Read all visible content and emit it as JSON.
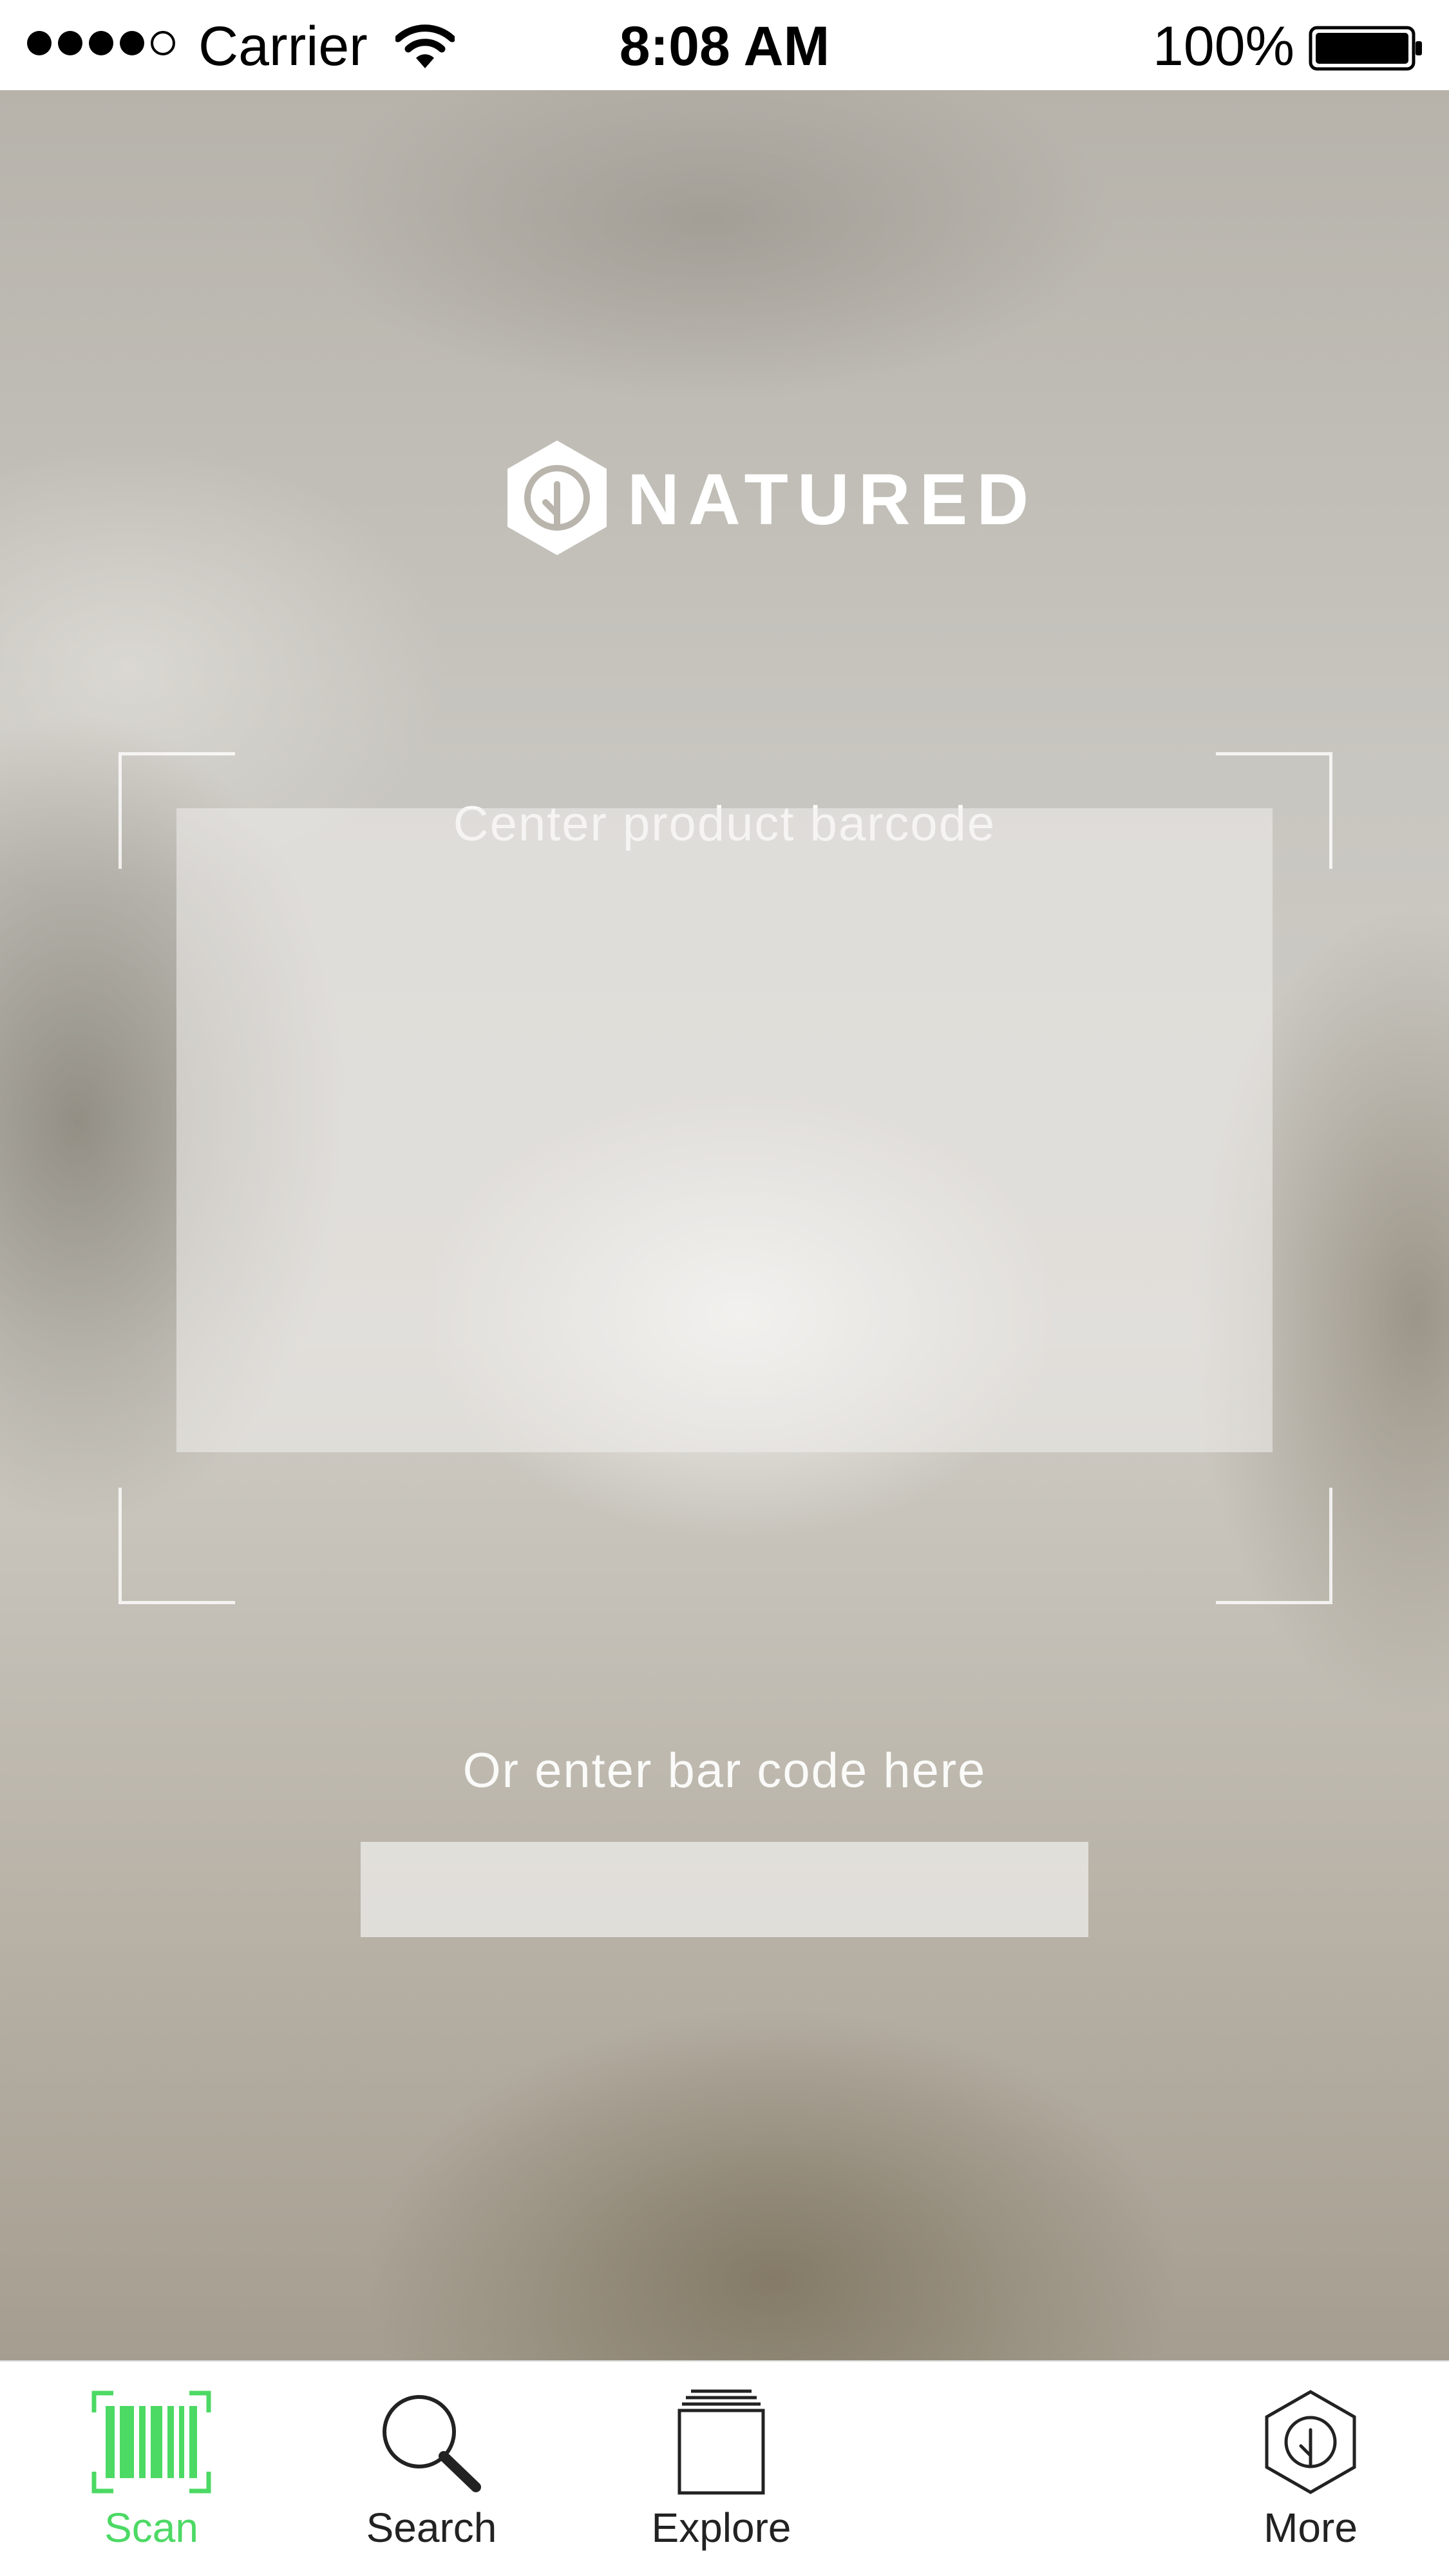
{
  "status_bar": {
    "carrier": "Carrier",
    "time": "8:08 AM",
    "battery_percent": "100%",
    "signal_bars_filled": 4,
    "signal_bars_total": 5
  },
  "brand": {
    "name": "NATURED",
    "logo_icon": "hexagon-tree-icon"
  },
  "scanner": {
    "instruction": "Center product barcode",
    "manual_entry_prompt": "Or enter bar code here",
    "barcode_input_value": "",
    "barcode_input_placeholder": ""
  },
  "tab_bar": {
    "active_tab": "scan",
    "active_color": "#4cd964",
    "tabs": [
      {
        "id": "scan",
        "label": "Scan",
        "icon": "barcode-scan-icon"
      },
      {
        "id": "search",
        "label": "Search",
        "icon": "magnifier-icon"
      },
      {
        "id": "explore",
        "label": "Explore",
        "icon": "stack-icon"
      },
      {
        "id": "more",
        "label": "More",
        "icon": "hexagon-tree-icon"
      }
    ]
  }
}
